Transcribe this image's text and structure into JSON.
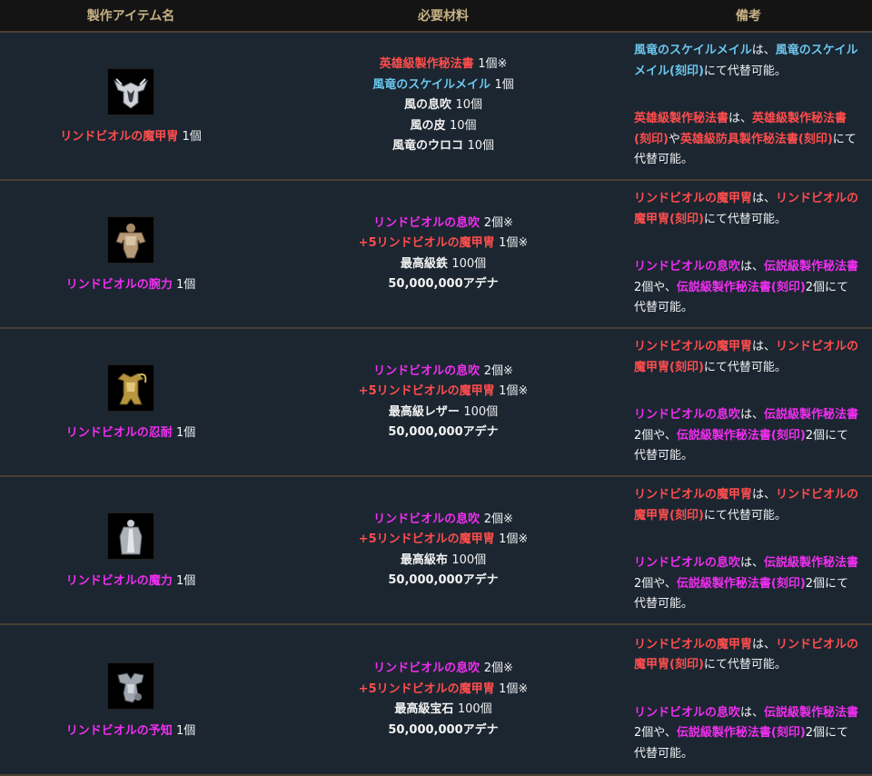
{
  "colors": {
    "red": "#ff4d4d",
    "magenta": "#f02ef0",
    "blue": "#6cc6ee",
    "header": "#c7b183"
  },
  "headers": [
    "製作アイテム名",
    "必要材料",
    "備考"
  ],
  "rows": [
    {
      "icon": "dragon-armor-icon",
      "item_name": "リンドビオルの魔甲冑",
      "item_qty": "1個",
      "materials": [
        {
          "name": "英雄級製作秘法書",
          "qty": "1個※"
        },
        {
          "name": "風竜のスケイルメイル",
          "qty": "1個"
        },
        {
          "name": "風の息吹",
          "qty": "10個"
        },
        {
          "name": "風の皮",
          "qty": "10個"
        },
        {
          "name": "風竜のウロコ",
          "qty": "10個"
        }
      ],
      "note1": {
        "a": "風竜のスケイルメイル",
        "b": "は、",
        "c": "風竜のスケイルメイル(刻印)",
        "d": "にて代替可能。"
      },
      "note2": {
        "a": "英雄級製作秘法書",
        "b": "は、",
        "c": "英雄級製作秘法書(刻印)",
        "d": "や",
        "e": "英雄級防具製作秘法書(刻印)",
        "f": "にて代替可能。"
      }
    },
    {
      "icon": "bronze-armor-icon",
      "item_name": "リンドビオルの腕力",
      "item_qty": "1個",
      "materials": [
        {
          "name": "リンドビオルの息吹",
          "qty": "2個※"
        },
        {
          "name": "+5リンドビオルの魔甲冑",
          "qty": "1個※"
        },
        {
          "name": "最高級鉄",
          "qty": "100個"
        },
        {
          "name": "50,000,000アデナ",
          "qty": ""
        }
      ],
      "note1": {
        "a": "リンドビオルの魔甲冑",
        "b": "は、",
        "c": "リンドビオルの魔甲冑(刻印)",
        "d": "にて代替可能。"
      },
      "note2": {
        "a": "リンドビオルの息吹",
        "b": "は、",
        "c": "伝説級製作秘法書",
        "d": "2個や、",
        "e": "伝説級製作秘法書(刻印)",
        "f": "2個にて代替可能。"
      }
    },
    {
      "icon": "golden-armor-icon",
      "item_name": "リンドビオルの忍耐",
      "item_qty": "1個",
      "materials": [
        {
          "name": "リンドビオルの息吹",
          "qty": "2個※"
        },
        {
          "name": "+5リンドビオルの魔甲冑",
          "qty": "1個※"
        },
        {
          "name": "最高級レザー",
          "qty": "100個"
        },
        {
          "name": "50,000,000アデナ",
          "qty": ""
        }
      ],
      "note1": {
        "a": "リンドビオルの魔甲冑",
        "b": "は、",
        "c": "リンドビオルの魔甲冑(刻印)",
        "d": "にて代替可能。"
      },
      "note2": {
        "a": "リンドビオルの息吹",
        "b": "は、",
        "c": "伝説級製作秘法書",
        "d": "2個や、",
        "e": "伝説級製作秘法書(刻印)",
        "f": "2個にて代替可能。"
      }
    },
    {
      "icon": "robe-armor-icon",
      "item_name": "リンドビオルの魔力",
      "item_qty": "1個",
      "materials": [
        {
          "name": "リンドビオルの息吹",
          "qty": "2個※"
        },
        {
          "name": "+5リンドビオルの魔甲冑",
          "qty": "1個※"
        },
        {
          "name": "最高級布",
          "qty": "100個"
        },
        {
          "name": "50,000,000アデナ",
          "qty": ""
        }
      ],
      "note1": {
        "a": "リンドビオルの魔甲冑",
        "b": "は、",
        "c": "リンドビオルの魔甲冑(刻印)",
        "d": "にて代替可能。"
      },
      "note2": {
        "a": "リンドビオルの息吹",
        "b": "は、",
        "c": "伝説級製作秘法書",
        "d": "2個や、",
        "e": "伝説級製作秘法書(刻印)",
        "f": "2個にて代替可能。"
      }
    },
    {
      "icon": "silver-armor-icon",
      "item_name": "リンドビオルの予知",
      "item_qty": "1個",
      "materials": [
        {
          "name": "リンドビオルの息吹",
          "qty": "2個※"
        },
        {
          "name": "+5リンドビオルの魔甲冑",
          "qty": "1個※"
        },
        {
          "name": "最高級宝石",
          "qty": "100個"
        },
        {
          "name": "50,000,000アデナ",
          "qty": ""
        }
      ],
      "note1": {
        "a": "リンドビオルの魔甲冑",
        "b": "は、",
        "c": "リンドビオルの魔甲冑(刻印)",
        "d": "にて代替可能。"
      },
      "note2": {
        "a": "リンドビオルの息吹",
        "b": "は、",
        "c": "伝説級製作秘法書",
        "d": "2個や、",
        "e": "伝説級製作秘法書(刻印)",
        "f": "2個にて代替可能。"
      }
    }
  ]
}
